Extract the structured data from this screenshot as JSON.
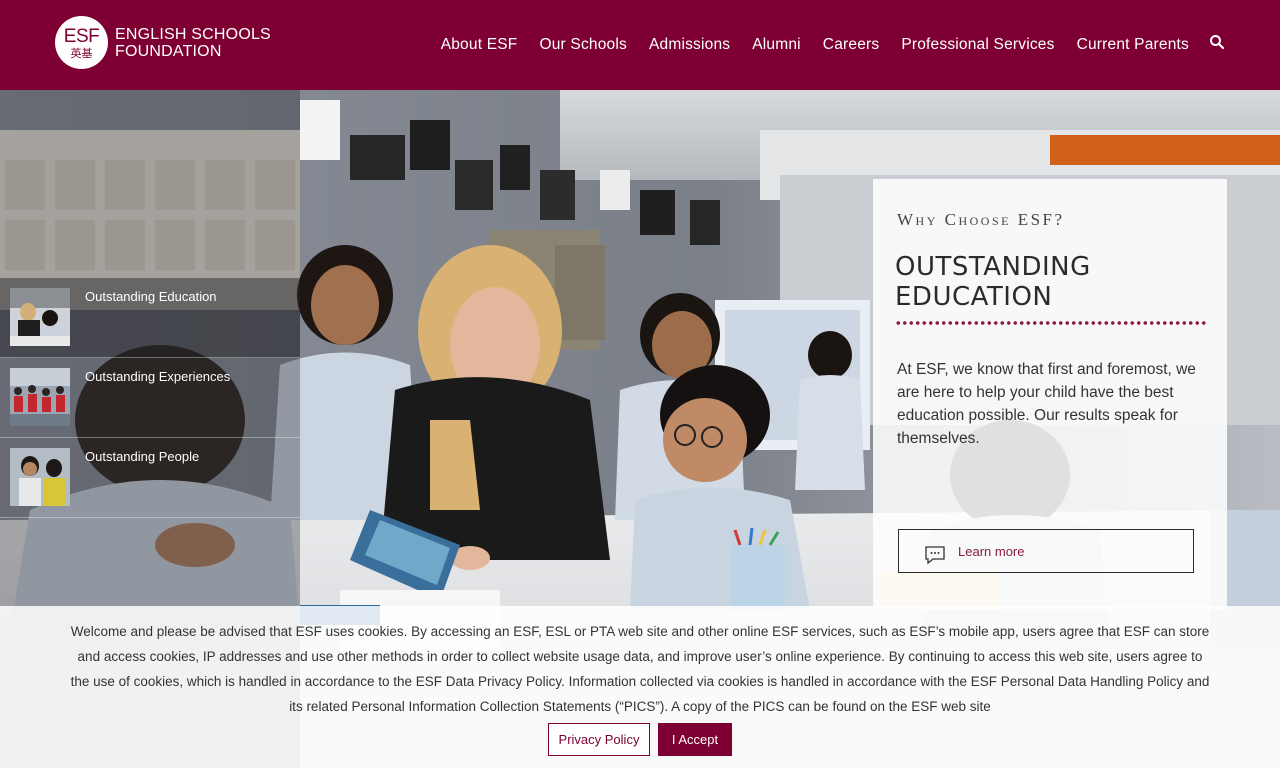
{
  "brand": {
    "logo_mark": "ESF",
    "logo_chinese": "英基",
    "name_line1": "ENGLISH SCHOOLS",
    "name_line2": "FOUNDATION",
    "primary_color": "#7e0032"
  },
  "nav": {
    "items": [
      {
        "label": "About ESF"
      },
      {
        "label": "Our Schools"
      },
      {
        "label": "Admissions"
      },
      {
        "label": "Alumni"
      },
      {
        "label": "Careers"
      },
      {
        "label": "Professional Services"
      },
      {
        "label": "Current Parents"
      }
    ],
    "search_icon": "search-icon"
  },
  "slides": [
    {
      "label": "Outstanding Education",
      "active": true
    },
    {
      "label": "Outstanding Experiences",
      "active": false
    },
    {
      "label": "Outstanding People",
      "active": false
    }
  ],
  "card": {
    "kicker": "Why Choose ESF?",
    "title": "OUTSTANDING EDUCATION",
    "body": "At ESF, we know that first and foremost, we are here to help your child have the best education possible. Our results speak for themselves.",
    "button_label": "Learn more",
    "button_icon": "chat-icon"
  },
  "cookie": {
    "message": "Welcome and please be advised that ESF uses cookies. By accessing an ESF, ESL or PTA web site and other online ESF services, such as ESF’s mobile app, users agree that ESF can store and access cookies, IP addresses and use other methods in order to collect website usage data, and improve user’s online experience. By continuing to access this web site, users agree to the use of cookies, which is handled in accordance to the ESF Data Privacy Policy. Information collected via cookies is handled in accordance with the ESF Personal Data Handling Policy and its related Personal Information Collection Statements (“PICS”). A copy of the PICS can be found on the ESF web site",
    "privacy_label": "Privacy Policy",
    "accept_label": "I Accept"
  }
}
